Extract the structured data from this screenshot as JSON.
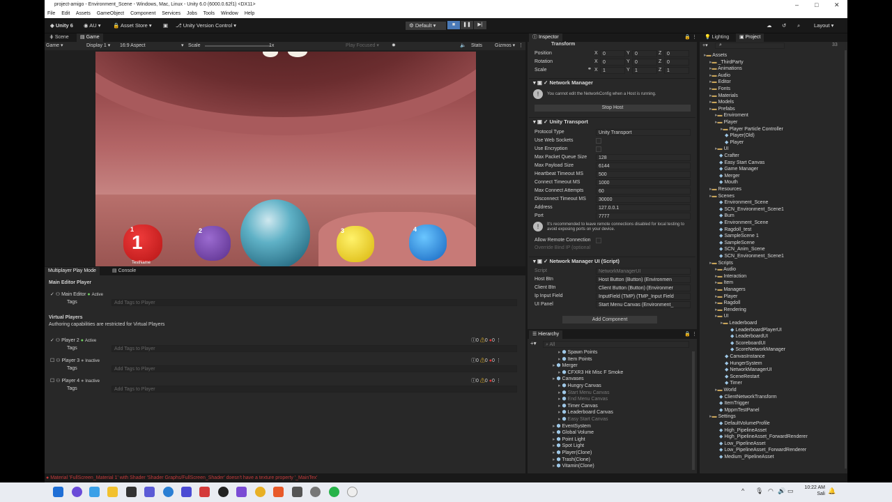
{
  "titlebar": {
    "title": "project-amigo - Environment_Scene - Windows, Mac, Linux - Unity 6.0 (6000.0.62f1) <DX11>"
  },
  "menu": [
    "File",
    "Edit",
    "Assets",
    "GameObject",
    "Component",
    "Services",
    "Jobs",
    "Tools",
    "Window",
    "Help"
  ],
  "toolbar": {
    "unity": "Unity 6",
    "account": "AU",
    "asset_store": "Asset Store",
    "version_control": "Unity Version Control",
    "play_mode": "Default",
    "layout": "Layout"
  },
  "scene_tabs": {
    "scene": "Scene",
    "game": "Game"
  },
  "game_bar": {
    "game": "Game",
    "display": "Display 1",
    "aspect": "16:9 Aspect",
    "scale_label": "Scale",
    "scale_value": "1x",
    "play_focused": "Play Focused",
    "stats": "Stats",
    "gizmos": "Gizmos"
  },
  "game_view": {
    "player_numbers": [
      "1",
      "2",
      "3",
      "4"
    ],
    "player_name": "TestName"
  },
  "multiplayer": {
    "tab1": "Multiplayer Play Mode",
    "tab2": "Console",
    "main_header": "Main Editor Player",
    "main_editor": "Main Editor",
    "active": "Active",
    "inactive": "Inactive",
    "tags": "Tags",
    "tags_placeholder": "Add Tags to Player",
    "virtual_header": "Virtual Players",
    "virtual_note": "Authoring capabilities are restricted for Virtual Players",
    "players": [
      {
        "name": "Player 2",
        "status": "Active"
      },
      {
        "name": "Player 3",
        "status": "Inactive"
      },
      {
        "name": "Player 4",
        "status": "Inactive"
      }
    ],
    "counts": "0"
  },
  "inspector": {
    "tab": "Inspector",
    "transform": "Transform",
    "position": "Position",
    "rotation": "Rotation",
    "scale": "Scale",
    "x": "X",
    "y": "Y",
    "z": "Z",
    "pos_vals": [
      "0",
      "0",
      "0"
    ],
    "rot_vals": [
      "0",
      "0",
      "0"
    ],
    "scale_vals": [
      "1",
      "1",
      "1"
    ],
    "network_manager": "Network Manager",
    "nm_warning": "You cannot edit the NetworkConfig when a Host is running.",
    "stop_host": "Stop Host",
    "unity_transport": "Unity Transport",
    "transport_fields": [
      {
        "label": "Protocol Type",
        "value": "Unity Transport"
      },
      {
        "label": "Use Web Sockets",
        "value": ""
      },
      {
        "label": "Use Encryption",
        "value": ""
      },
      {
        "label": "Max Packet Queue Size",
        "value": "128"
      },
      {
        "label": "Max Payload Size",
        "value": "6144"
      },
      {
        "label": "Heartbeat Timeout MS",
        "value": "500"
      },
      {
        "label": "Connect Timeout MS",
        "value": "1000"
      },
      {
        "label": "Max Connect Attempts",
        "value": "60"
      },
      {
        "label": "Disconnect Timeout MS",
        "value": "30000"
      },
      {
        "label": "Address",
        "value": "127.0.0.1"
      },
      {
        "label": "Port",
        "value": "7777"
      }
    ],
    "transport_warning": "It's recommended to leave remote connections disabled for local testing to avoid exposing ports on your device.",
    "allow_remote": "Allow Remote Connection",
    "override_bind": "Override Bind IP (optional",
    "nmui": "Network Manager UI (Script)",
    "nmui_fields": [
      {
        "label": "Script",
        "value": "NetworkManagerUI"
      },
      {
        "label": "Host Btn",
        "value": "Host Button (Button) (Environmen"
      },
      {
        "label": "Client Btn",
        "value": "Client Button (Button) (Environmer"
      },
      {
        "label": "Ip Input Field",
        "value": "InputField (TMP) (TMP_Input Field"
      },
      {
        "label": "UI Panel",
        "value": "Start Menu Canvas (Environment_"
      }
    ],
    "add_component": "Add Component"
  },
  "hierarchy": {
    "tab": "Hierarchy",
    "search": "All",
    "items": [
      {
        "t": "Spawn Points",
        "d": 2,
        "g": false
      },
      {
        "t": "Item Points",
        "d": 2,
        "g": false
      },
      {
        "t": "Merger",
        "d": 1,
        "g": false
      },
      {
        "t": "CFXR3 Hit Misc F Smoke",
        "d": 2,
        "g": false
      },
      {
        "t": "Canvases",
        "d": 1,
        "g": false
      },
      {
        "t": "Hungry Canvas",
        "d": 2,
        "g": false
      },
      {
        "t": "Start Menu Canvas",
        "d": 2,
        "g": true
      },
      {
        "t": "End Menu Canvas",
        "d": 2,
        "g": true
      },
      {
        "t": "Timer Canvas",
        "d": 2,
        "g": false
      },
      {
        "t": "Leaderboard Canvas",
        "d": 2,
        "g": false
      },
      {
        "t": "Easy Start Canvas",
        "d": 2,
        "g": true
      },
      {
        "t": "EventSystem",
        "d": 1,
        "g": false
      },
      {
        "t": "Global Volume",
        "d": 1,
        "g": false
      },
      {
        "t": "Point Light",
        "d": 1,
        "g": false
      },
      {
        "t": "Spot Light",
        "d": 1,
        "g": false
      },
      {
        "t": "Player(Clone)",
        "d": 1,
        "g": false
      },
      {
        "t": "Trash(Clone)",
        "d": 1,
        "g": false
      },
      {
        "t": "Vitamin(Clone)",
        "d": 1,
        "g": false
      }
    ]
  },
  "project": {
    "tab_lighting": "Lighting",
    "tab_project": "Project",
    "count": "33",
    "items": [
      {
        "t": "Assets",
        "d": 0,
        "f": true
      },
      {
        "t": "_ThirdParty",
        "d": 1,
        "f": true
      },
      {
        "t": "Animations",
        "d": 1,
        "f": true
      },
      {
        "t": "Audio",
        "d": 1,
        "f": true
      },
      {
        "t": "Editor",
        "d": 1,
        "f": true
      },
      {
        "t": "Fonts",
        "d": 1,
        "f": true
      },
      {
        "t": "Materials",
        "d": 1,
        "f": true
      },
      {
        "t": "Models",
        "d": 1,
        "f": true
      },
      {
        "t": "Prefabs",
        "d": 1,
        "f": true
      },
      {
        "t": "Enviroment",
        "d": 2,
        "f": true
      },
      {
        "t": "Player",
        "d": 2,
        "f": true
      },
      {
        "t": "Player Particle Controller",
        "d": 3,
        "f": true
      },
      {
        "t": "Player(Old)",
        "d": 3,
        "f": false
      },
      {
        "t": "Player",
        "d": 3,
        "f": false
      },
      {
        "t": "UI",
        "d": 2,
        "f": true
      },
      {
        "t": "Crafter",
        "d": 2,
        "f": false
      },
      {
        "t": "Easy Start Canvas",
        "d": 2,
        "f": false
      },
      {
        "t": "Game Manager",
        "d": 2,
        "f": false
      },
      {
        "t": "Merger",
        "d": 2,
        "f": false
      },
      {
        "t": "Mouth",
        "d": 2,
        "f": false
      },
      {
        "t": "Resources",
        "d": 1,
        "f": true
      },
      {
        "t": "Scenes",
        "d": 1,
        "f": true
      },
      {
        "t": "Environment_Scene",
        "d": 2,
        "f": false
      },
      {
        "t": "SCN_Environment_Scene1",
        "d": 2,
        "f": false
      },
      {
        "t": "Bum",
        "d": 2,
        "f": false
      },
      {
        "t": "Environment_Scene",
        "d": 2,
        "f": false
      },
      {
        "t": "Ragdoll_test",
        "d": 2,
        "f": false
      },
      {
        "t": "SampleScene 1",
        "d": 2,
        "f": false
      },
      {
        "t": "SampleScene",
        "d": 2,
        "f": false
      },
      {
        "t": "SCN_Anim_Scene",
        "d": 2,
        "f": false
      },
      {
        "t": "SCN_Environment_Scene1",
        "d": 2,
        "f": false
      },
      {
        "t": "Scripts",
        "d": 1,
        "f": true
      },
      {
        "t": "Audio",
        "d": 2,
        "f": true
      },
      {
        "t": "Interaction",
        "d": 2,
        "f": true
      },
      {
        "t": "Item",
        "d": 2,
        "f": true
      },
      {
        "t": "Managers",
        "d": 2,
        "f": true
      },
      {
        "t": "Player",
        "d": 2,
        "f": true
      },
      {
        "t": "Ragdoll",
        "d": 2,
        "f": true
      },
      {
        "t": "Rendering",
        "d": 2,
        "f": true
      },
      {
        "t": "UI",
        "d": 2,
        "f": true
      },
      {
        "t": "Leaderboard",
        "d": 3,
        "f": true
      },
      {
        "t": "LeaderboardPlayerUI",
        "d": 4,
        "f": false
      },
      {
        "t": "LeaderboardUI",
        "d": 4,
        "f": false
      },
      {
        "t": "ScoreboardUI",
        "d": 4,
        "f": false
      },
      {
        "t": "ScoreNetworkManager",
        "d": 4,
        "f": false
      },
      {
        "t": "CanvasInstance",
        "d": 3,
        "f": false
      },
      {
        "t": "HungerSystem",
        "d": 3,
        "f": false
      },
      {
        "t": "NetworkManagerUI",
        "d": 3,
        "f": false
      },
      {
        "t": "SceneRestart",
        "d": 3,
        "f": false
      },
      {
        "t": "Timer",
        "d": 3,
        "f": false
      },
      {
        "t": "World",
        "d": 2,
        "f": true
      },
      {
        "t": "ClientNetworkTransform",
        "d": 2,
        "f": false
      },
      {
        "t": "ItemTrigger",
        "d": 2,
        "f": false
      },
      {
        "t": "MppmTestPanel",
        "d": 2,
        "f": false
      },
      {
        "t": "Settings",
        "d": 1,
        "f": true
      },
      {
        "t": "DefaultVolumeProfile",
        "d": 2,
        "f": false
      },
      {
        "t": "High_PipelineAsset",
        "d": 2,
        "f": false
      },
      {
        "t": "High_PipelineAsset_ForwardRenderer",
        "d": 2,
        "f": false
      },
      {
        "t": "Low_PipelineAsset",
        "d": 2,
        "f": false
      },
      {
        "t": "Low_PipelineAsset_ForwardRenderer",
        "d": 2,
        "f": false
      },
      {
        "t": "Medium_PipelineAsset",
        "d": 2,
        "f": false
      }
    ]
  },
  "status": {
    "error": "Material 'FullScreen_Material 1' with Shader 'Shader Graphs/FullScreen_Shader' doesn't have a texture property '_MainTex'"
  },
  "taskbar": {
    "time": "10:22 AM",
    "day": "Sali"
  }
}
